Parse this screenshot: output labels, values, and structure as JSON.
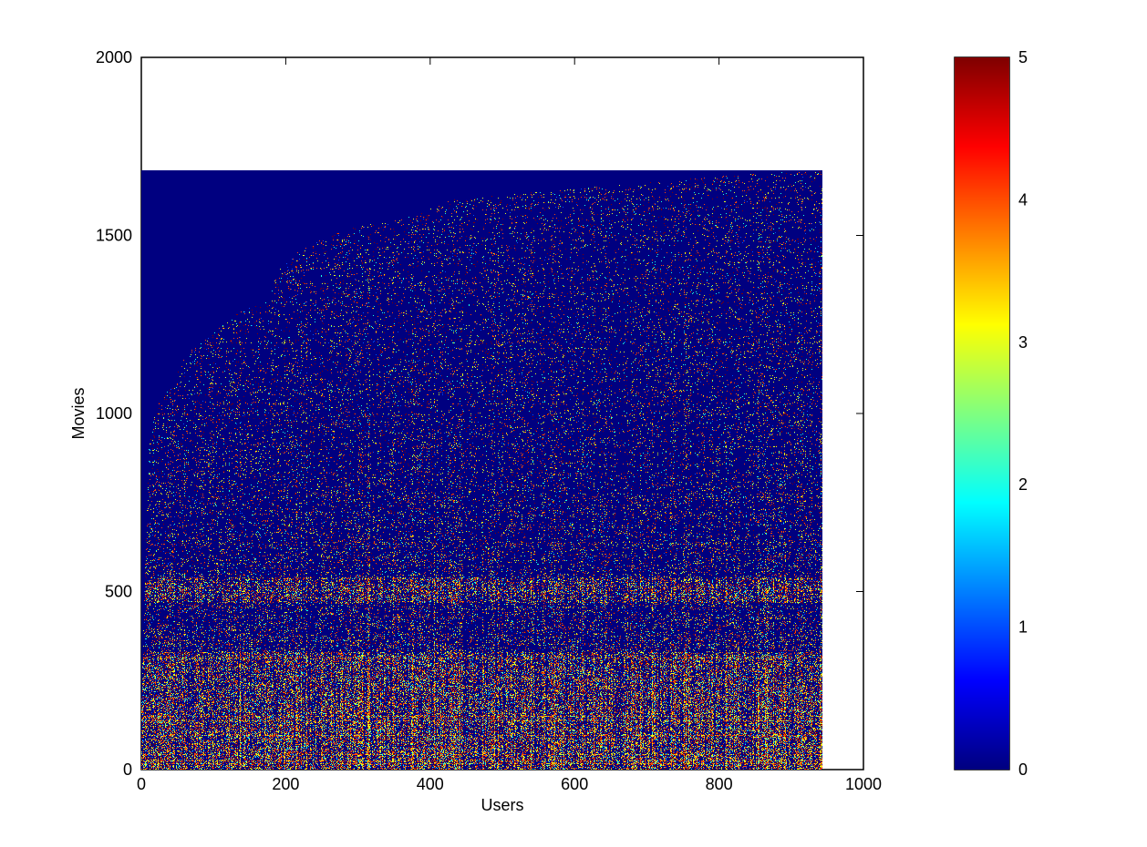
{
  "chart_data": {
    "type": "heatmap",
    "title": "",
    "xlabel": "Users",
    "ylabel": "Movies",
    "xlim": [
      0,
      1000
    ],
    "ylim": [
      0,
      2000
    ],
    "x_ticks": [
      0,
      200,
      400,
      600,
      800,
      1000
    ],
    "y_ticks": [
      0,
      500,
      1000,
      1500,
      2000
    ],
    "x_tick_labels": [
      "0",
      "200",
      "400",
      "600",
      "800",
      "1000"
    ],
    "y_tick_labels": [
      "0",
      "500",
      "1000",
      "1500",
      "2000"
    ],
    "matrix": {
      "users": 943,
      "movies": 1682
    },
    "value_range": [
      0,
      5
    ],
    "colorbar": {
      "colormap": "jet",
      "ticks": [
        0,
        1,
        2,
        3,
        4,
        5
      ],
      "tick_labels": [
        "0",
        "1",
        "2",
        "3",
        "4",
        "5"
      ],
      "placement": "right"
    },
    "grid": false,
    "dense_bands_movies": [
      [
        0,
        330
      ],
      [
        470,
        540
      ]
    ],
    "sparse_frontier": [
      [
        0,
        200
      ],
      [
        5,
        600
      ],
      [
        10,
        900
      ],
      [
        20,
        1020
      ],
      [
        40,
        1080
      ],
      [
        60,
        1160
      ],
      [
        90,
        1220
      ],
      [
        120,
        1270
      ],
      [
        150,
        1300
      ],
      [
        180,
        1320
      ],
      [
        181,
        1395
      ],
      [
        220,
        1460
      ],
      [
        260,
        1500
      ],
      [
        300,
        1530
      ],
      [
        340,
        1545
      ],
      [
        380,
        1560
      ],
      [
        405,
        1580
      ],
      [
        430,
        1600
      ],
      [
        500,
        1615
      ],
      [
        560,
        1625
      ],
      [
        650,
        1640
      ],
      [
        760,
        1660
      ],
      [
        880,
        1678
      ],
      [
        943,
        1682
      ]
    ]
  }
}
